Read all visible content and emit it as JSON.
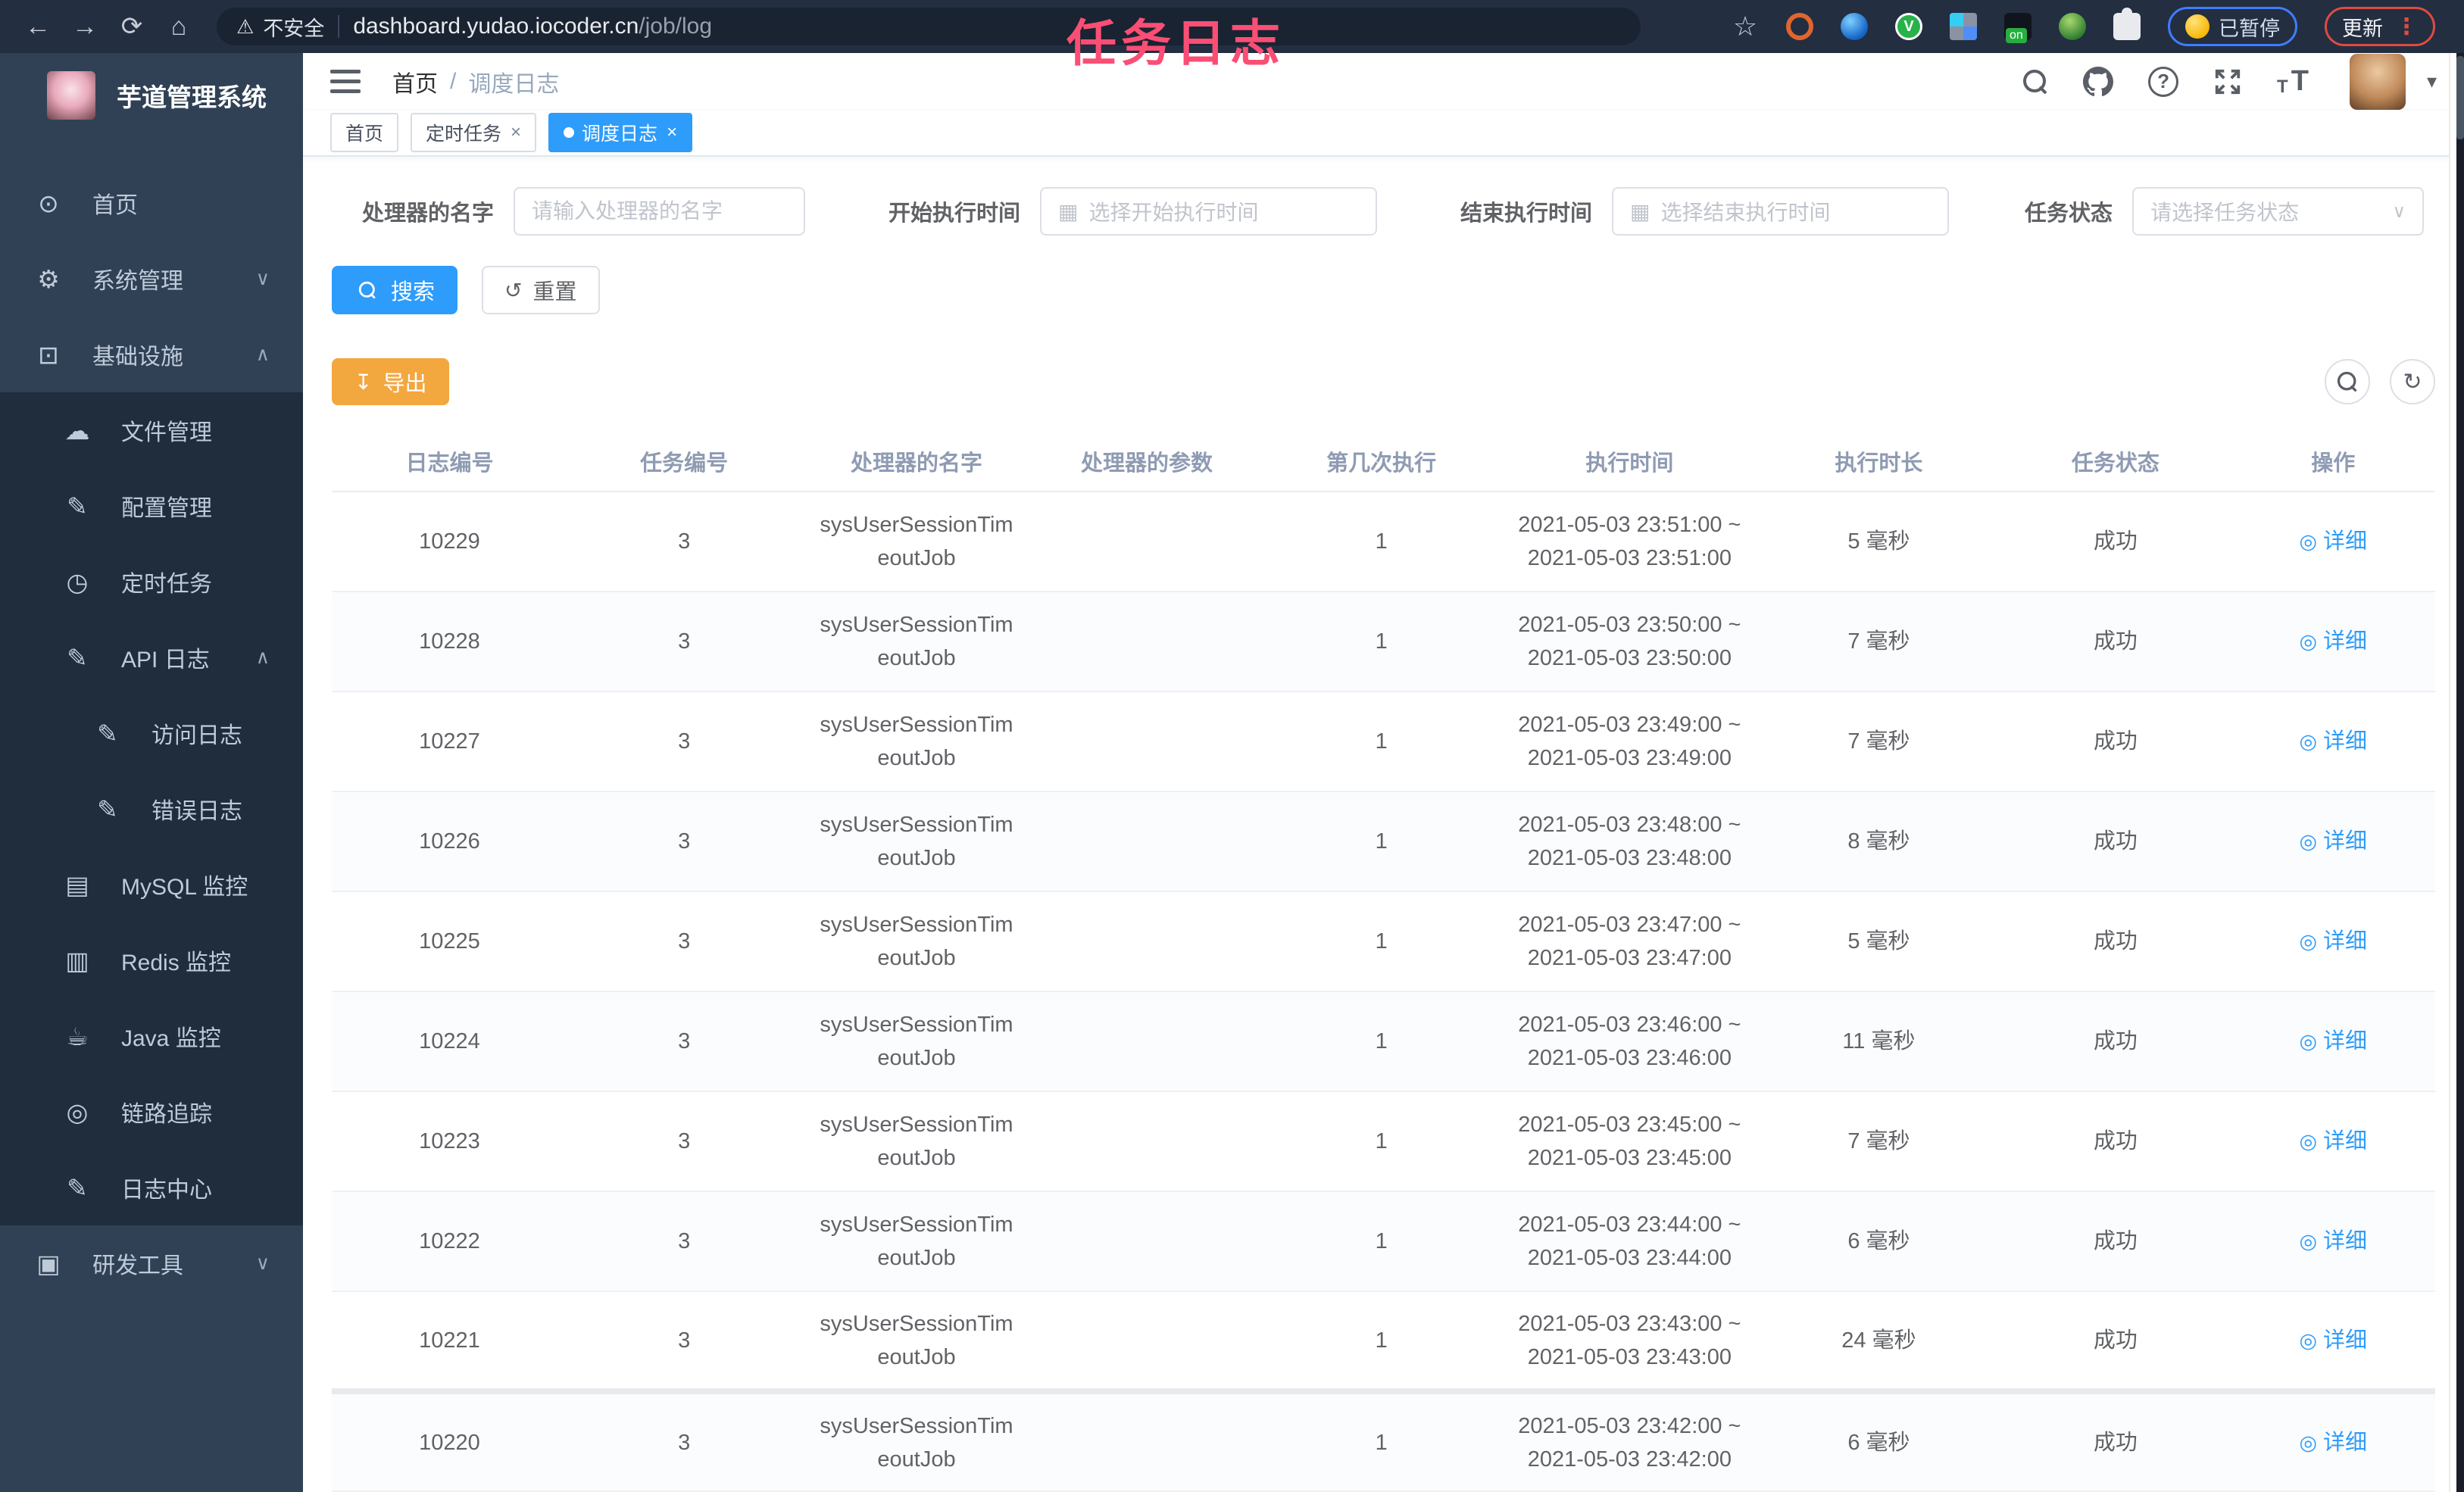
{
  "watermark": {
    "text": "任务日志",
    "color": "#fb4e75"
  },
  "colors": {
    "accent": "#2d9cfb",
    "warning": "#f3a73f",
    "sidebar_bg": "#304156",
    "submenu_bg": "#1f2d3d",
    "active_tag": "#2d9cfb"
  },
  "icons": {
    "back": "←",
    "forward": "→",
    "reload": "⟳",
    "home": "⌂",
    "warning": "⚠",
    "star": "☆",
    "kebab": "⋮",
    "caret": "▾",
    "calendar": "▦",
    "chevron_down": "∨",
    "chevron_up": "∧",
    "reset": "↺",
    "refresh": "↻",
    "download": "↧",
    "eye": "◎",
    "close": "×",
    "dot_menu_v": "V",
    "ext_on": "on"
  },
  "browser": {
    "security_label": "不安全",
    "url_host": "dashboard.yudao.iocoder.cn",
    "url_path": "/job/log",
    "paused_label": "已暂停",
    "update_label": "更新"
  },
  "sidebar": {
    "app_title": "芋道管理系统",
    "items": [
      {
        "icon": "dashboard-icon",
        "glyph": "⊙",
        "label": "首页",
        "level": 1,
        "chevron": null
      },
      {
        "icon": "gear-icon",
        "glyph": "⚙",
        "label": "系统管理",
        "level": 1,
        "chevron": "down"
      },
      {
        "icon": "monitor-icon",
        "glyph": "⊡",
        "label": "基础设施",
        "level": 1,
        "chevron": "up"
      },
      {
        "icon": "upload-cloud-icon",
        "glyph": "☁",
        "label": "文件管理",
        "level": 2,
        "chevron": null
      },
      {
        "icon": "edit-icon",
        "glyph": "✎",
        "label": "配置管理",
        "level": 2,
        "chevron": null
      },
      {
        "icon": "timer-icon",
        "glyph": "◷",
        "label": "定时任务",
        "level": 2,
        "chevron": null
      },
      {
        "icon": "api-log-icon",
        "glyph": "✎",
        "label": "API 日志",
        "level": 2,
        "chevron": "up"
      },
      {
        "icon": "access-log-icon",
        "glyph": "✎",
        "label": "访问日志",
        "level": 3,
        "chevron": null
      },
      {
        "icon": "error-log-icon",
        "glyph": "✎",
        "label": "错误日志",
        "level": 3,
        "chevron": null
      },
      {
        "icon": "mysql-icon",
        "glyph": "▤",
        "label": "MySQL 监控",
        "level": 2,
        "chevron": null
      },
      {
        "icon": "redis-icon",
        "glyph": "▥",
        "label": "Redis 监控",
        "level": 2,
        "chevron": null
      },
      {
        "icon": "java-icon",
        "glyph": "☕",
        "label": "Java 监控",
        "level": 2,
        "chevron": null
      },
      {
        "icon": "trace-eye-icon",
        "glyph": "◎",
        "label": "链路追踪",
        "level": 2,
        "chevron": null
      },
      {
        "icon": "log-center-icon",
        "glyph": "✎",
        "label": "日志中心",
        "level": 2,
        "chevron": null
      },
      {
        "icon": "toolbox-icon",
        "glyph": "▣",
        "label": "研发工具",
        "level": 1,
        "chevron": "down"
      }
    ]
  },
  "header": {
    "breadcrumb_home": "首页",
    "breadcrumb_separator": "/",
    "breadcrumb_current": "调度日志"
  },
  "tags": [
    {
      "label": "首页",
      "closable": false,
      "active": false
    },
    {
      "label": "定时任务",
      "closable": true,
      "active": false
    },
    {
      "label": "调度日志",
      "closable": true,
      "active": true
    }
  ],
  "filters": [
    {
      "label": "处理器的名字",
      "placeholder": "请输入处理器的名字",
      "type": "text"
    },
    {
      "label": "开始执行时间",
      "placeholder": "选择开始执行时间",
      "type": "date"
    },
    {
      "label": "结束执行时间",
      "placeholder": "选择结束执行时间",
      "type": "date"
    },
    {
      "label": "任务状态",
      "placeholder": "请选择任务状态",
      "type": "select"
    }
  ],
  "actions": {
    "search_label": "搜索",
    "reset_label": "重置",
    "export_label": "导出"
  },
  "table": {
    "columns": [
      "日志编号",
      "任务编号",
      "处理器的名字",
      "处理器的参数",
      "第几次执行",
      "执行时间",
      "执行时长",
      "任务状态",
      "操作"
    ],
    "detail_label": "详细",
    "rows": [
      {
        "log_id": "10229",
        "job_id": "3",
        "handler_lines": [
          "sysUserSessionTim",
          "eoutJob"
        ],
        "param": "",
        "execute_index": "1",
        "time_lines": [
          "2021-05-03 23:51:00 ~",
          "2021-05-03 23:51:00"
        ],
        "duration": "5 毫秒",
        "status": "成功"
      },
      {
        "log_id": "10228",
        "job_id": "3",
        "handler_lines": [
          "sysUserSessionTim",
          "eoutJob"
        ],
        "param": "",
        "execute_index": "1",
        "time_lines": [
          "2021-05-03 23:50:00 ~",
          "2021-05-03 23:50:00"
        ],
        "duration": "7 毫秒",
        "status": "成功"
      },
      {
        "log_id": "10227",
        "job_id": "3",
        "handler_lines": [
          "sysUserSessionTim",
          "eoutJob"
        ],
        "param": "",
        "execute_index": "1",
        "time_lines": [
          "2021-05-03 23:49:00 ~",
          "2021-05-03 23:49:00"
        ],
        "duration": "7 毫秒",
        "status": "成功"
      },
      {
        "log_id": "10226",
        "job_id": "3",
        "handler_lines": [
          "sysUserSessionTim",
          "eoutJob"
        ],
        "param": "",
        "execute_index": "1",
        "time_lines": [
          "2021-05-03 23:48:00 ~",
          "2021-05-03 23:48:00"
        ],
        "duration": "8 毫秒",
        "status": "成功"
      },
      {
        "log_id": "10225",
        "job_id": "3",
        "handler_lines": [
          "sysUserSessionTim",
          "eoutJob"
        ],
        "param": "",
        "execute_index": "1",
        "time_lines": [
          "2021-05-03 23:47:00 ~",
          "2021-05-03 23:47:00"
        ],
        "duration": "5 毫秒",
        "status": "成功"
      },
      {
        "log_id": "10224",
        "job_id": "3",
        "handler_lines": [
          "sysUserSessionTim",
          "eoutJob"
        ],
        "param": "",
        "execute_index": "1",
        "time_lines": [
          "2021-05-03 23:46:00 ~",
          "2021-05-03 23:46:00"
        ],
        "duration": "11 毫秒",
        "status": "成功"
      },
      {
        "log_id": "10223",
        "job_id": "3",
        "handler_lines": [
          "sysUserSessionTim",
          "eoutJob"
        ],
        "param": "",
        "execute_index": "1",
        "time_lines": [
          "2021-05-03 23:45:00 ~",
          "2021-05-03 23:45:00"
        ],
        "duration": "7 毫秒",
        "status": "成功"
      },
      {
        "log_id": "10222",
        "job_id": "3",
        "handler_lines": [
          "sysUserSessionTim",
          "eoutJob"
        ],
        "param": "",
        "execute_index": "1",
        "time_lines": [
          "2021-05-03 23:44:00 ~",
          "2021-05-03 23:44:00"
        ],
        "duration": "6 毫秒",
        "status": "成功"
      },
      {
        "log_id": "10221",
        "job_id": "3",
        "handler_lines": [
          "sysUserSessionTim",
          "eoutJob"
        ],
        "param": "",
        "execute_index": "1",
        "time_lines": [
          "2021-05-03 23:43:00 ~",
          "2021-05-03 23:43:00"
        ],
        "duration": "24 毫秒",
        "status": "成功"
      },
      {
        "log_id": "10220",
        "job_id": "3",
        "handler_lines": [
          "sysUserSessionTim",
          "eoutJob"
        ],
        "param": "",
        "execute_index": "1",
        "time_lines": [
          "2021-05-03 23:42:00 ~",
          "2021-05-03 23:42:00"
        ],
        "duration": "6 毫秒",
        "status": "成功"
      }
    ]
  }
}
